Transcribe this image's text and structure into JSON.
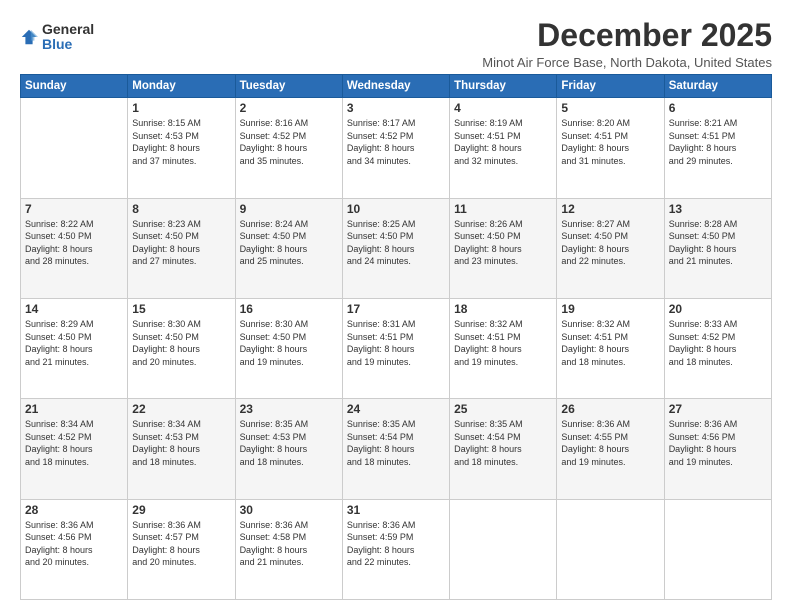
{
  "logo": {
    "general": "General",
    "blue": "Blue"
  },
  "title": "December 2025",
  "subtitle": "Minot Air Force Base, North Dakota, United States",
  "days_header": [
    "Sunday",
    "Monday",
    "Tuesday",
    "Wednesday",
    "Thursday",
    "Friday",
    "Saturday"
  ],
  "weeks": [
    [
      {
        "day": "",
        "info": ""
      },
      {
        "day": "1",
        "info": "Sunrise: 8:15 AM\nSunset: 4:53 PM\nDaylight: 8 hours\nand 37 minutes."
      },
      {
        "day": "2",
        "info": "Sunrise: 8:16 AM\nSunset: 4:52 PM\nDaylight: 8 hours\nand 35 minutes."
      },
      {
        "day": "3",
        "info": "Sunrise: 8:17 AM\nSunset: 4:52 PM\nDaylight: 8 hours\nand 34 minutes."
      },
      {
        "day": "4",
        "info": "Sunrise: 8:19 AM\nSunset: 4:51 PM\nDaylight: 8 hours\nand 32 minutes."
      },
      {
        "day": "5",
        "info": "Sunrise: 8:20 AM\nSunset: 4:51 PM\nDaylight: 8 hours\nand 31 minutes."
      },
      {
        "day": "6",
        "info": "Sunrise: 8:21 AM\nSunset: 4:51 PM\nDaylight: 8 hours\nand 29 minutes."
      }
    ],
    [
      {
        "day": "7",
        "info": "Sunrise: 8:22 AM\nSunset: 4:50 PM\nDaylight: 8 hours\nand 28 minutes."
      },
      {
        "day": "8",
        "info": "Sunrise: 8:23 AM\nSunset: 4:50 PM\nDaylight: 8 hours\nand 27 minutes."
      },
      {
        "day": "9",
        "info": "Sunrise: 8:24 AM\nSunset: 4:50 PM\nDaylight: 8 hours\nand 25 minutes."
      },
      {
        "day": "10",
        "info": "Sunrise: 8:25 AM\nSunset: 4:50 PM\nDaylight: 8 hours\nand 24 minutes."
      },
      {
        "day": "11",
        "info": "Sunrise: 8:26 AM\nSunset: 4:50 PM\nDaylight: 8 hours\nand 23 minutes."
      },
      {
        "day": "12",
        "info": "Sunrise: 8:27 AM\nSunset: 4:50 PM\nDaylight: 8 hours\nand 22 minutes."
      },
      {
        "day": "13",
        "info": "Sunrise: 8:28 AM\nSunset: 4:50 PM\nDaylight: 8 hours\nand 21 minutes."
      }
    ],
    [
      {
        "day": "14",
        "info": "Sunrise: 8:29 AM\nSunset: 4:50 PM\nDaylight: 8 hours\nand 21 minutes."
      },
      {
        "day": "15",
        "info": "Sunrise: 8:30 AM\nSunset: 4:50 PM\nDaylight: 8 hours\nand 20 minutes."
      },
      {
        "day": "16",
        "info": "Sunrise: 8:30 AM\nSunset: 4:50 PM\nDaylight: 8 hours\nand 19 minutes."
      },
      {
        "day": "17",
        "info": "Sunrise: 8:31 AM\nSunset: 4:51 PM\nDaylight: 8 hours\nand 19 minutes."
      },
      {
        "day": "18",
        "info": "Sunrise: 8:32 AM\nSunset: 4:51 PM\nDaylight: 8 hours\nand 19 minutes."
      },
      {
        "day": "19",
        "info": "Sunrise: 8:32 AM\nSunset: 4:51 PM\nDaylight: 8 hours\nand 18 minutes."
      },
      {
        "day": "20",
        "info": "Sunrise: 8:33 AM\nSunset: 4:52 PM\nDaylight: 8 hours\nand 18 minutes."
      }
    ],
    [
      {
        "day": "21",
        "info": "Sunrise: 8:34 AM\nSunset: 4:52 PM\nDaylight: 8 hours\nand 18 minutes."
      },
      {
        "day": "22",
        "info": "Sunrise: 8:34 AM\nSunset: 4:53 PM\nDaylight: 8 hours\nand 18 minutes."
      },
      {
        "day": "23",
        "info": "Sunrise: 8:35 AM\nSunset: 4:53 PM\nDaylight: 8 hours\nand 18 minutes."
      },
      {
        "day": "24",
        "info": "Sunrise: 8:35 AM\nSunset: 4:54 PM\nDaylight: 8 hours\nand 18 minutes."
      },
      {
        "day": "25",
        "info": "Sunrise: 8:35 AM\nSunset: 4:54 PM\nDaylight: 8 hours\nand 18 minutes."
      },
      {
        "day": "26",
        "info": "Sunrise: 8:36 AM\nSunset: 4:55 PM\nDaylight: 8 hours\nand 19 minutes."
      },
      {
        "day": "27",
        "info": "Sunrise: 8:36 AM\nSunset: 4:56 PM\nDaylight: 8 hours\nand 19 minutes."
      }
    ],
    [
      {
        "day": "28",
        "info": "Sunrise: 8:36 AM\nSunset: 4:56 PM\nDaylight: 8 hours\nand 20 minutes."
      },
      {
        "day": "29",
        "info": "Sunrise: 8:36 AM\nSunset: 4:57 PM\nDaylight: 8 hours\nand 20 minutes."
      },
      {
        "day": "30",
        "info": "Sunrise: 8:36 AM\nSunset: 4:58 PM\nDaylight: 8 hours\nand 21 minutes."
      },
      {
        "day": "31",
        "info": "Sunrise: 8:36 AM\nSunset: 4:59 PM\nDaylight: 8 hours\nand 22 minutes."
      },
      {
        "day": "",
        "info": ""
      },
      {
        "day": "",
        "info": ""
      },
      {
        "day": "",
        "info": ""
      }
    ]
  ]
}
